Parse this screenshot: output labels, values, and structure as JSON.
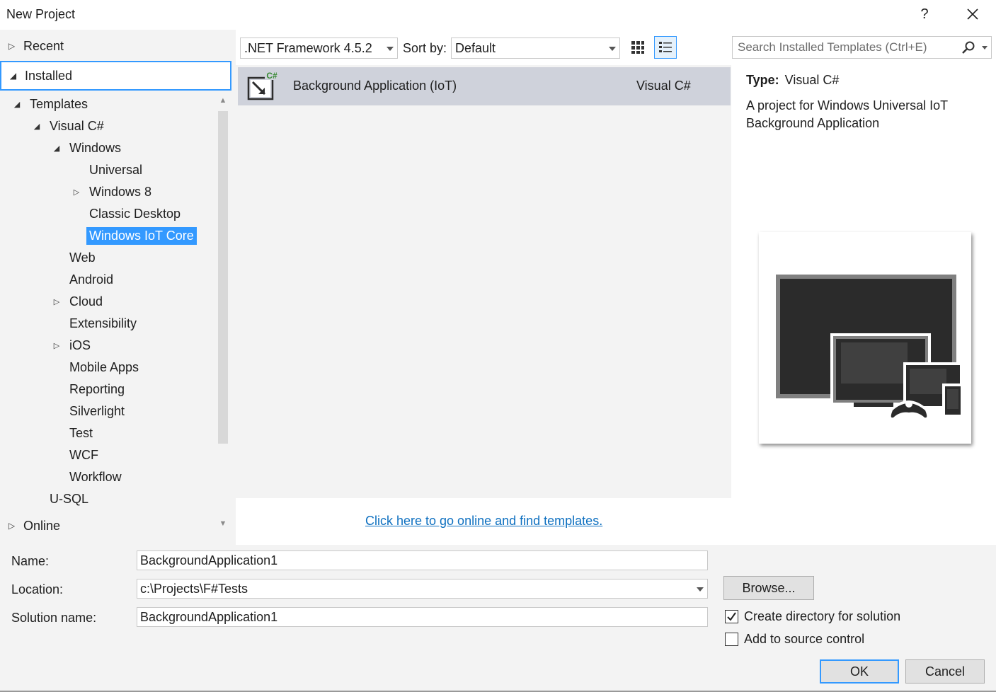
{
  "window": {
    "title": "New Project",
    "help_label": "?"
  },
  "categories": {
    "recent": "Recent",
    "installed": "Installed",
    "online": "Online"
  },
  "tree": [
    {
      "label": "Templates",
      "level": 0,
      "expander": "expanded"
    },
    {
      "label": "Visual C#",
      "level": 1,
      "expander": "expanded"
    },
    {
      "label": "Windows",
      "level": 2,
      "expander": "expanded"
    },
    {
      "label": "Universal",
      "level": 3,
      "expander": "none"
    },
    {
      "label": "Windows 8",
      "level": 3,
      "expander": "collapsed"
    },
    {
      "label": "Classic Desktop",
      "level": 3,
      "expander": "none"
    },
    {
      "label": "Windows IoT Core",
      "level": 3,
      "expander": "none",
      "selected": true
    },
    {
      "label": "Web",
      "level": 2,
      "expander": "none"
    },
    {
      "label": "Android",
      "level": 2,
      "expander": "none"
    },
    {
      "label": "Cloud",
      "level": 2,
      "expander": "collapsed"
    },
    {
      "label": "Extensibility",
      "level": 2,
      "expander": "none"
    },
    {
      "label": "iOS",
      "level": 2,
      "expander": "collapsed"
    },
    {
      "label": "Mobile Apps",
      "level": 2,
      "expander": "none"
    },
    {
      "label": "Reporting",
      "level": 2,
      "expander": "none"
    },
    {
      "label": "Silverlight",
      "level": 2,
      "expander": "none"
    },
    {
      "label": "Test",
      "level": 2,
      "expander": "none"
    },
    {
      "label": "WCF",
      "level": 2,
      "expander": "none"
    },
    {
      "label": "Workflow",
      "level": 2,
      "expander": "none"
    },
    {
      "label": "U-SQL",
      "level": 1,
      "expander": "none"
    }
  ],
  "toolbar": {
    "framework": ".NET Framework 4.5.2",
    "sort_label": "Sort by:",
    "sort_value": "Default",
    "search_placeholder": "Search Installed Templates (Ctrl+E)"
  },
  "templates": [
    {
      "name": "Background Application (IoT)",
      "language": "Visual C#",
      "icon": "iot-background-app-icon",
      "badge": "C#"
    }
  ],
  "online_link": "Click here to go online and find templates.",
  "description": {
    "type_label": "Type:",
    "type_value": "Visual C#",
    "text": "A project for Windows Universal IoT Background Application"
  },
  "form": {
    "name_label": "Name:",
    "name_value": "BackgroundApplication1",
    "location_label": "Location:",
    "location_value": "c:\\Projects\\F#Tests",
    "solution_label": "Solution name:",
    "solution_value": "BackgroundApplication1",
    "browse_label": "Browse...",
    "create_dir_label": "Create directory for solution",
    "create_dir_checked": true,
    "source_control_label": "Add to source control",
    "source_control_checked": false,
    "ok_label": "OK",
    "cancel_label": "Cancel"
  },
  "colors": {
    "accent": "#3399ff",
    "link": "#0e70c0",
    "selected_row": "#cfd2db",
    "panel_bg": "#f3f3f3"
  }
}
